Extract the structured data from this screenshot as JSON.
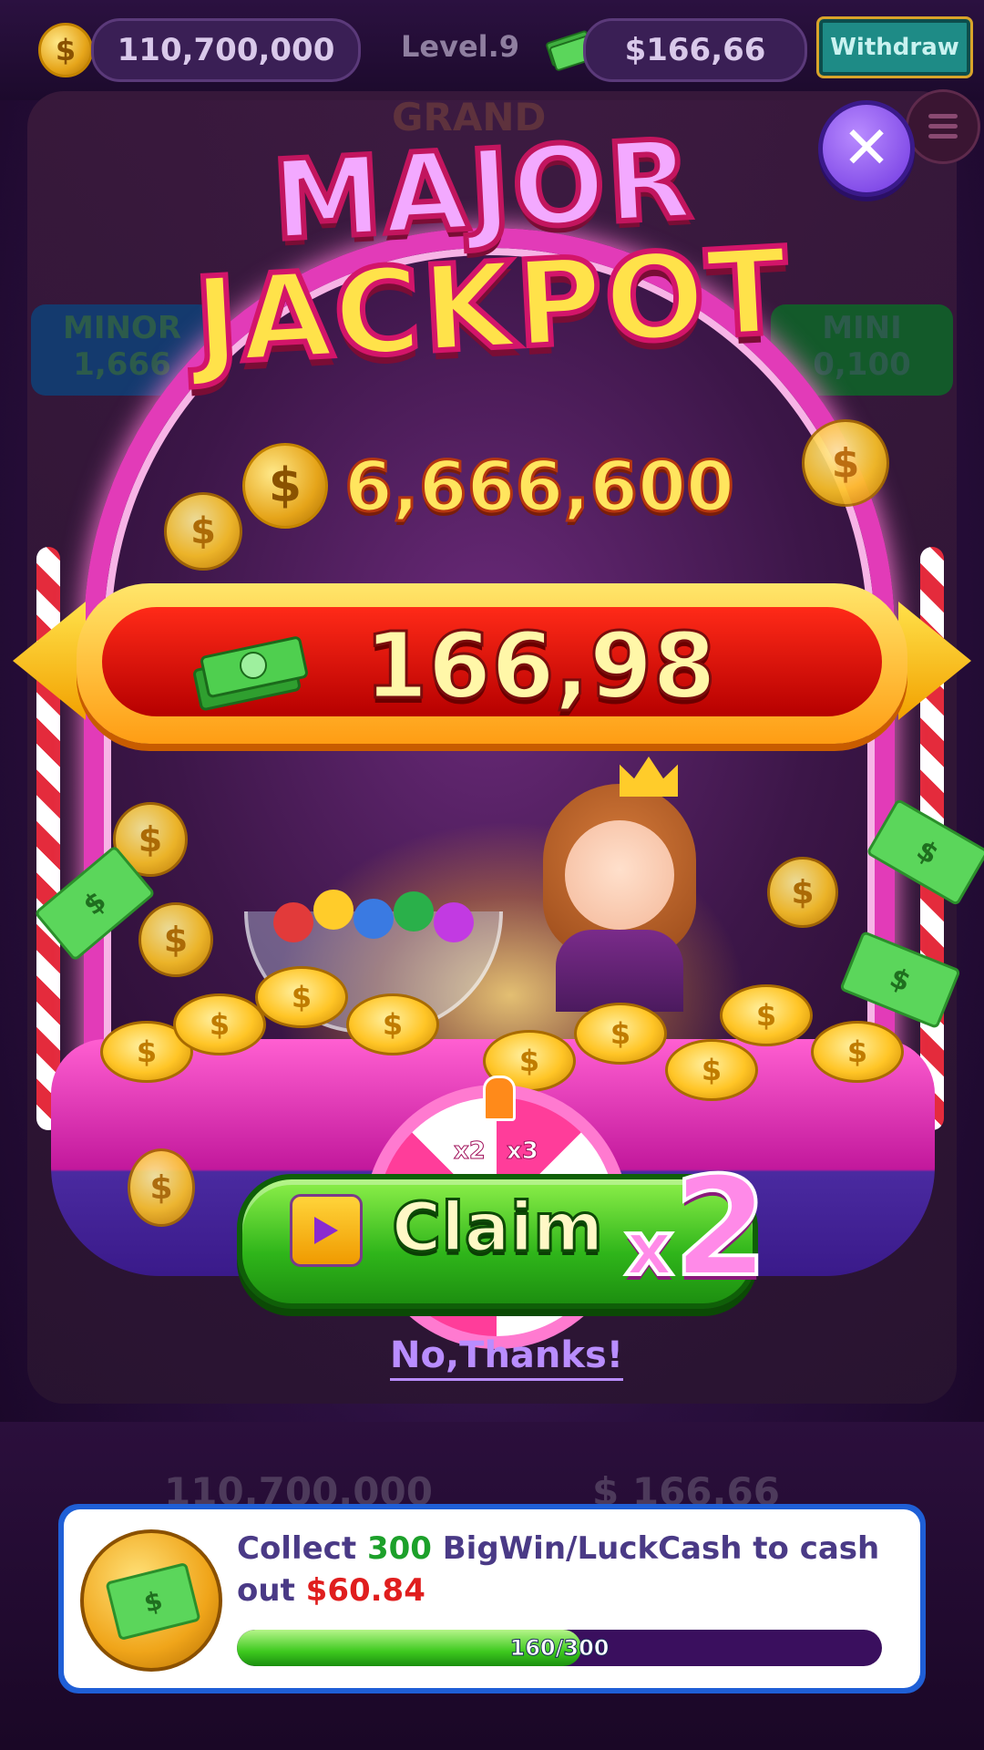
{
  "hud": {
    "coins": "110,700,000",
    "level": "Level.9",
    "cash": "$166,66",
    "withdraw_label": "Withdraw",
    "coin_symbol": "$"
  },
  "background": {
    "grand_label": "GRAND",
    "minor_label": "MINOR",
    "minor_value": "1,666",
    "mini_label": "MINI",
    "mini_value": "0,100",
    "bottom_coins": "110,700,000",
    "bottom_cash": "$ 166,66"
  },
  "popup": {
    "title_line1": "MAJOR",
    "title_line2": "JACKPOT",
    "coin_reward": "6,666,600",
    "cash_reward": "166,98",
    "claim_label": "Claim",
    "claim_multiplier_x": "x",
    "claim_multiplier_n": "2",
    "wheel_labels": [
      "x2",
      "x3"
    ],
    "close_symbol": "✕",
    "no_thanks": "No,Thanks!"
  },
  "cashout_card": {
    "text_prefix": "Collect ",
    "goal_count": "300",
    "text_middle": " BigWin/LuckCash to cash out ",
    "cashout_amount": "$60.84",
    "progress_current": 160,
    "progress_total": 300,
    "progress_label": "160/300"
  },
  "colors": {
    "accent_pink": "#e23bb8",
    "claim_green": "#2fb51a",
    "card_border": "#1f5fd6",
    "progress_track": "#3a0f5e"
  },
  "icons": [
    "coin-icon",
    "cash-stack-icon",
    "menu-icon",
    "close-icon",
    "video-ad-icon"
  ]
}
